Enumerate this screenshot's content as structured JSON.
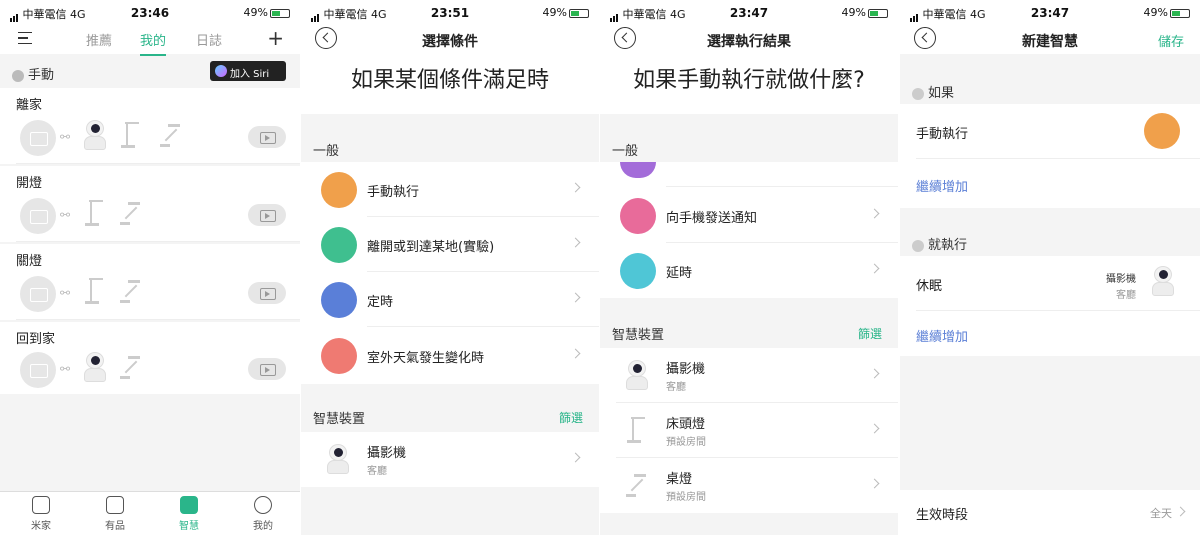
{
  "status_bars": [
    {
      "carrier": "中華電信",
      "net": "4G",
      "time": "23:46",
      "battery": "49%"
    },
    {
      "carrier": "中華電信",
      "net": "4G",
      "time": "23:51",
      "battery": "49%"
    },
    {
      "carrier": "中華電信",
      "net": "4G",
      "time": "23:47",
      "battery": "49%"
    },
    {
      "carrier": "中華電信",
      "net": "4G",
      "time": "23:47",
      "battery": "49%"
    }
  ],
  "screen1": {
    "tabs": [
      "推薦",
      "我的",
      "日誌"
    ],
    "active_tab": "我的",
    "section_label": "手動",
    "siri_button": "加入 Siri",
    "groups": [
      "離家",
      "開燈",
      "關燈",
      "回到家"
    ],
    "bottom_tabs": [
      "米家",
      "有品",
      "智慧",
      "我的"
    ],
    "active_bottom_tab": "智慧"
  },
  "screen2": {
    "title": "選擇條件",
    "headline": "如果某個條件滿足時",
    "section_general": "一般",
    "items": [
      {
        "label": "手動執行",
        "icon": "cursor-icon",
        "color": "#f0a04b"
      },
      {
        "label": "離開或到達某地(實驗)",
        "icon": "location-pin-icon",
        "color": "#3fbf8f"
      },
      {
        "label": "定時",
        "icon": "clock-icon",
        "color": "#5a7fd8"
      },
      {
        "label": "室外天氣發生變化時",
        "icon": "weather-icon",
        "color": "#ef7a72"
      }
    ],
    "section_devices": "智慧裝置",
    "filter_label": "篩選",
    "devices": [
      {
        "name": "攝影機",
        "room": "客廳"
      }
    ]
  },
  "screen3": {
    "title": "選擇執行結果",
    "headline": "如果手動執行就做什麼?",
    "section_general": "一般",
    "items": [
      {
        "label": "向手機發送通知",
        "icon": "phone-vibrate-icon",
        "color": "#e86b9a"
      },
      {
        "label": "延時",
        "icon": "timer-icon",
        "color": "#4fc6d6"
      }
    ],
    "section_devices": "智慧裝置",
    "filter_label": "篩選",
    "devices": [
      {
        "name": "攝影機",
        "room": "客廳"
      },
      {
        "name": "床頭燈",
        "room": "預設房間"
      },
      {
        "name": "桌燈",
        "room": "預設房間"
      }
    ]
  },
  "screen4": {
    "title": "新建智慧",
    "save_label": "儲存",
    "if_label": "如果",
    "if_item": "手動執行",
    "add_more": "繼續增加",
    "then_label": "就執行",
    "then_item": "休眠",
    "then_device": "攝影機",
    "then_room": "客廳",
    "add_more2": "繼續增加",
    "period_label": "生效時段",
    "period_value": "全天"
  }
}
